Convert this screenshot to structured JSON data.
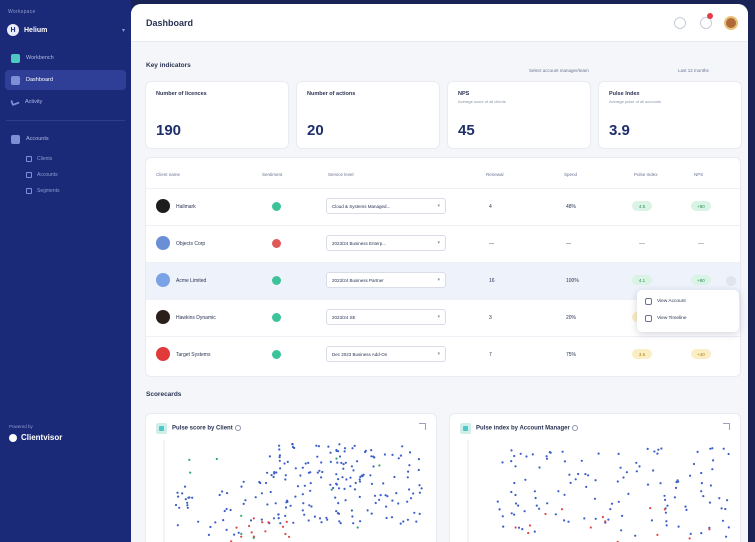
{
  "sidebar": {
    "workspace_label": "Workspace",
    "workspace_name": "Helium",
    "items": [
      {
        "label": "Workbench",
        "active": false
      },
      {
        "label": "Dashboard",
        "active": true
      },
      {
        "label": "Activity",
        "active": false
      }
    ],
    "section": "Accounts",
    "sub_items": [
      {
        "label": "Clients"
      },
      {
        "label": "Accounts"
      },
      {
        "label": "Segments"
      }
    ],
    "powered_by": "Powered by",
    "brand": "Clientvisor"
  },
  "header": {
    "title": "Dashboard"
  },
  "kpi_section": {
    "title": "Key indicators",
    "links": [
      "Select account manager/team",
      "Last 12 months"
    ]
  },
  "kpis": [
    {
      "title": "Number of licences",
      "subtitle": "",
      "value": "190"
    },
    {
      "title": "Number of actions",
      "subtitle": "",
      "value": "20"
    },
    {
      "title": "NPS",
      "subtitle": "Average score of all clients",
      "value": "45"
    },
    {
      "title": "Pulse Index",
      "subtitle": "Average pulse of all accounts",
      "value": "3.9"
    }
  ],
  "table": {
    "columns": [
      "Client name",
      "Sentiment",
      "Service level",
      "Renewal",
      "Spend",
      "Pulse Index",
      "NPS"
    ],
    "rows": [
      {
        "name": "Hallmark",
        "logo_color": "#1d1d1d",
        "status_color": "#3cc39a",
        "service": "Cloud & Systems Managed...",
        "renewal": "4",
        "spend": "48%",
        "pulse": "4.5",
        "pulse_color": "green",
        "nps": "+80",
        "nps_color": "green"
      },
      {
        "name": "Objects Corp",
        "logo_color": "#6b8fd6",
        "status_color": "#e05757",
        "service": "2023/24 Business Enterp...",
        "renewal": "—",
        "spend": "—",
        "pulse": "—",
        "pulse_color": "none",
        "nps": "—",
        "nps_color": "none"
      },
      {
        "name": "Acme Limited",
        "logo_color": "#7aa3e6",
        "status_color": "#3cc39a",
        "service": "2023/24 Business Partner",
        "renewal": "16",
        "spend": "100%",
        "pulse": "4.1",
        "pulse_color": "green",
        "nps": "+80",
        "nps_color": "green"
      },
      {
        "name": "Hawkins Dynamic",
        "logo_color": "#2a1f1a",
        "status_color": "#3cc39a",
        "service": "2023/24 SE",
        "renewal": "3",
        "spend": "20%",
        "pulse": "3.2",
        "pulse_color": "yellow",
        "nps": "+20",
        "nps_color": "yellow"
      },
      {
        "name": "Target Systems",
        "logo_color": "#e03a3a",
        "status_color": "#3cc39a",
        "service": "Dec 2023 Business Add-On",
        "renewal": "7",
        "spend": "75%",
        "pulse": "3.6",
        "pulse_color": "yellow",
        "nps": "+40",
        "nps_color": "yellow"
      }
    ]
  },
  "context_menu": {
    "items": [
      "View Account",
      "View Timeline"
    ]
  },
  "scorecards": {
    "title": "Scorecards",
    "charts": [
      {
        "title": "Pulse score by Client"
      },
      {
        "title": "Pulse index by Account Manager"
      }
    ]
  },
  "chart_data": [
    {
      "type": "scatter",
      "title": "Pulse score by Client",
      "ylabel": "",
      "series": [
        {
          "color": "#3b5ec8"
        },
        {
          "color": "#e04747"
        },
        {
          "color": "#2ea66e"
        }
      ]
    },
    {
      "type": "scatter",
      "title": "Pulse index by Account Manager",
      "ylabel": "",
      "series": [
        {
          "color": "#3b5ec8"
        },
        {
          "color": "#e04747"
        }
      ]
    }
  ]
}
